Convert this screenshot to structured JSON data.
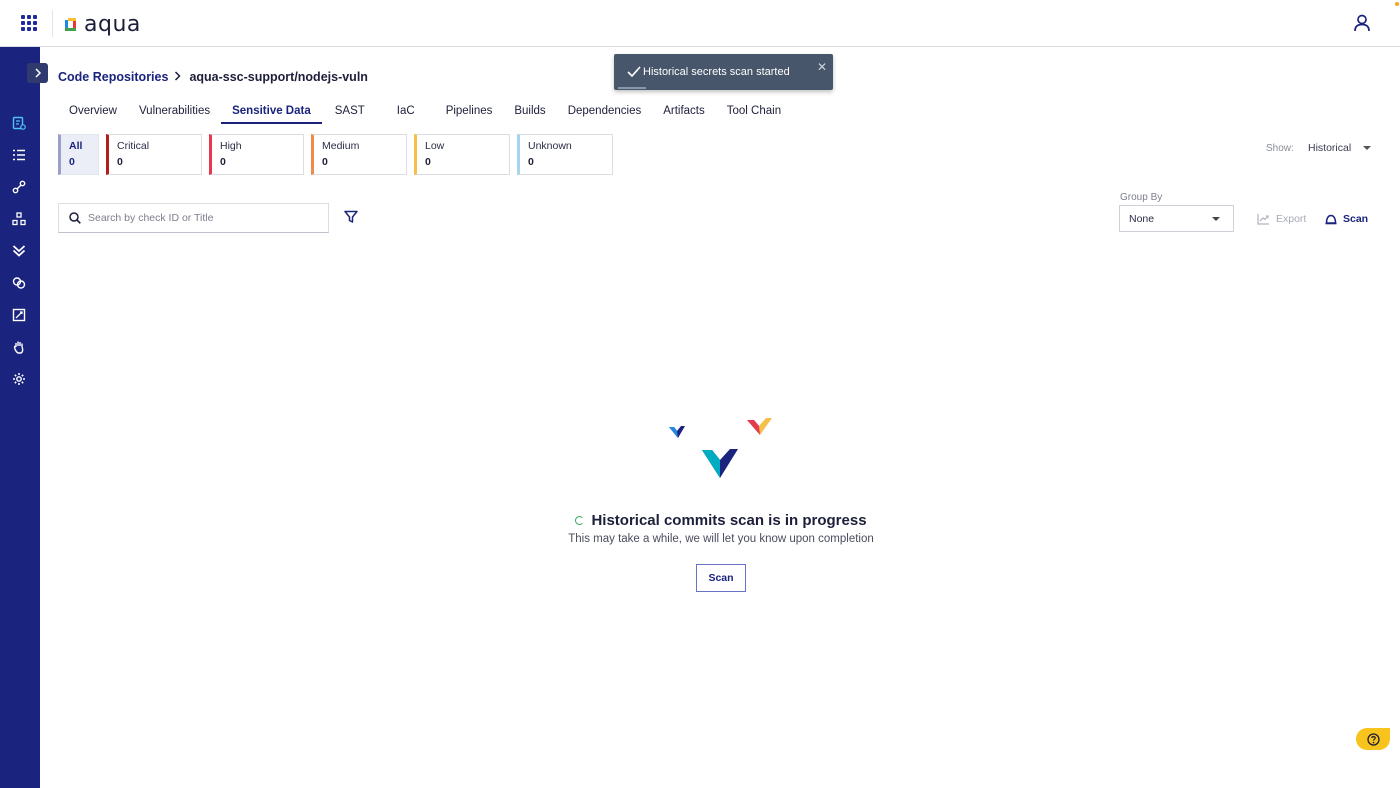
{
  "brand": {
    "logo_text": "aqua"
  },
  "breadcrumb": {
    "parent": "Code Repositories",
    "current": "aqua-ssc-support/nodejs-vuln"
  },
  "tabs": [
    "Overview",
    "Vulnerabilities",
    "Sensitive Data",
    "SAST",
    "IaC",
    "Pipelines",
    "Builds",
    "Dependencies",
    "Artifacts",
    "Tool Chain"
  ],
  "active_tab": "Sensitive Data",
  "severity": [
    {
      "label": "All",
      "count": "0",
      "color": "#9aa0c8"
    },
    {
      "label": "Critical",
      "count": "0",
      "color": "#b71c1c"
    },
    {
      "label": "High",
      "count": "0",
      "color": "#e53950"
    },
    {
      "label": "Medium",
      "count": "0",
      "color": "#f08a4b"
    },
    {
      "label": "Low",
      "count": "0",
      "color": "#f5c04a"
    },
    {
      "label": "Unknown",
      "count": "0",
      "color": "#a9d4ee"
    }
  ],
  "show": {
    "label": "Show:",
    "value": "Historical"
  },
  "search": {
    "placeholder": "Search by check ID or Title"
  },
  "group_by": {
    "label": "Group By",
    "value": "None"
  },
  "actions": {
    "export": "Export",
    "scan": "Scan"
  },
  "toast": {
    "message": "Historical secrets scan started",
    "close": "✕"
  },
  "empty_state": {
    "title": "Historical commits scan is in progress",
    "subtitle": "This may take a while, we will let you know upon completion",
    "button": "Scan"
  },
  "help": {
    "icon": "question-icon"
  },
  "colors": {
    "primary": "#1a237e",
    "sidebar": "#1a237e",
    "toast_bg": "#47566a",
    "help": "#f7c31c",
    "success": "#35a853"
  }
}
